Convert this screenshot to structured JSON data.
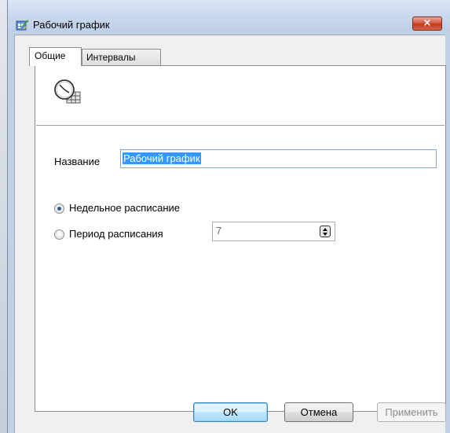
{
  "window": {
    "title": "Рабочий график",
    "close_glyph": "×"
  },
  "tabs": [
    {
      "label": "Общие",
      "active": true
    },
    {
      "label": "Интервалы",
      "active": false
    }
  ],
  "general": {
    "icon": "clock-calendar-icon",
    "name_label": "Название",
    "name_value": "Рабочий график",
    "options": [
      {
        "label": "Недельное расписание",
        "checked": true
      },
      {
        "label": "Период расписания",
        "checked": false
      }
    ],
    "period_value": "7"
  },
  "buttons": {
    "ok": "OK",
    "cancel": "Отмена",
    "apply": "Применить"
  },
  "colors": {
    "selection": "#3399ff",
    "close_button": "#c1391e",
    "window_frame": "#c0d1e6"
  }
}
